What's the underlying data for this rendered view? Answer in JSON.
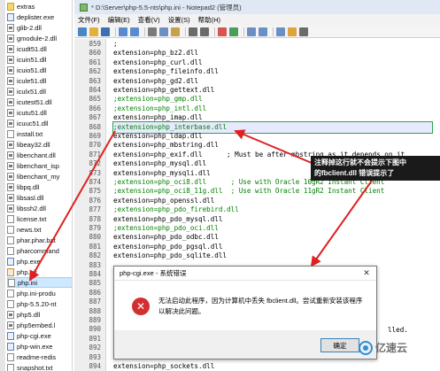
{
  "explorer": {
    "files": [
      {
        "name": "extras",
        "type": "folder"
      },
      {
        "name": "deplister.exe",
        "type": "exe"
      },
      {
        "name": "glib-2.dll",
        "type": "dll"
      },
      {
        "name": "gmodule-2.dll",
        "type": "dll"
      },
      {
        "name": "icudt51.dll",
        "type": "dll"
      },
      {
        "name": "icuin51.dll",
        "type": "dll"
      },
      {
        "name": "icuio51.dll",
        "type": "dll"
      },
      {
        "name": "icule51.dll",
        "type": "dll"
      },
      {
        "name": "iculx51.dll",
        "type": "dll"
      },
      {
        "name": "icutest51.dll",
        "type": "dll"
      },
      {
        "name": "icutu51.dll",
        "type": "dll"
      },
      {
        "name": "icuuc51.dll",
        "type": "dll"
      },
      {
        "name": "install.txt",
        "type": "txt"
      },
      {
        "name": "libeay32.dll",
        "type": "dll"
      },
      {
        "name": "libenchant.dll",
        "type": "dll"
      },
      {
        "name": "libenchant_isp",
        "type": "dll"
      },
      {
        "name": "libenchant_my",
        "type": "dll"
      },
      {
        "name": "libpq.dll",
        "type": "dll"
      },
      {
        "name": "libsasl.dll",
        "type": "dll"
      },
      {
        "name": "libssh2.dll",
        "type": "dll"
      },
      {
        "name": "license.txt",
        "type": "txt"
      },
      {
        "name": "news.txt",
        "type": "txt"
      },
      {
        "name": "phar.phar.bat",
        "type": "txt"
      },
      {
        "name": "pharcommand",
        "type": "txt"
      },
      {
        "name": "php.exe",
        "type": "exe"
      },
      {
        "name": "php.gif",
        "type": "gif"
      },
      {
        "name": "php.ini",
        "type": "ini",
        "selected": true
      },
      {
        "name": "php.ini-produ",
        "type": "ini"
      },
      {
        "name": "php-5.5.20-nt",
        "type": "txt"
      },
      {
        "name": "php5.dll",
        "type": "dll"
      },
      {
        "name": "php5embed.l",
        "type": "dll"
      },
      {
        "name": "php-cgi.exe",
        "type": "exe"
      },
      {
        "name": "php-win.exe",
        "type": "exe"
      },
      {
        "name": "readme-redis",
        "type": "txt"
      },
      {
        "name": "snapshot.txt",
        "type": "txt"
      }
    ]
  },
  "window": {
    "title": "* D:\\Server\\php-5.5-nts\\php.ini - Notepad2 (管理员)"
  },
  "menu": [
    "文件(F)",
    "编辑(E)",
    "查看(V)",
    "设置(S)",
    "帮助(H)"
  ],
  "toolbar": {
    "buttons": [
      {
        "icon": "new-file-icon",
        "color": "#4a86c5"
      },
      {
        "icon": "open-folder-icon",
        "color": "#e0b23a"
      },
      {
        "icon": "save-icon",
        "color": "#3f6fb0"
      },
      {
        "sep": true
      },
      {
        "icon": "undo-icon",
        "color": "#5a8ad0"
      },
      {
        "icon": "redo-icon",
        "color": "#5a8ad0"
      },
      {
        "sep": true
      },
      {
        "icon": "cut-icon",
        "color": "#7a7a7a"
      },
      {
        "icon": "copy-icon",
        "color": "#6a8fc0"
      },
      {
        "icon": "paste-icon",
        "color": "#c9a048"
      },
      {
        "sep": true
      },
      {
        "icon": "find-icon",
        "color": "#6b6b6b"
      },
      {
        "icon": "replace-icon",
        "color": "#6b6b6b"
      },
      {
        "sep": true
      },
      {
        "icon": "wordwrap-icon",
        "color": "#d9534f"
      },
      {
        "icon": "settings-icon",
        "color": "#4a9d5b"
      },
      {
        "sep": true
      },
      {
        "icon": "zoom-in-icon",
        "color": "#6b8fc5"
      },
      {
        "icon": "zoom-out-icon",
        "color": "#6b8fc5"
      },
      {
        "sep": true
      },
      {
        "icon": "view-icon",
        "color": "#6b8fc5"
      },
      {
        "icon": "favorites-icon",
        "color": "#e0a23a"
      },
      {
        "icon": "print-icon",
        "color": "#6b6b6b"
      }
    ]
  },
  "editor": {
    "lines": [
      {
        "no": "859",
        "text": ";",
        "style": "plain"
      },
      {
        "no": "860",
        "text": "extension=php_bz2.dll",
        "style": "plain"
      },
      {
        "no": "861",
        "text": "extension=php_curl.dll",
        "style": "plain"
      },
      {
        "no": "862",
        "text": "extension=php_fileinfo.dll",
        "style": "plain"
      },
      {
        "no": "863",
        "text": "extension=php_gd2.dll",
        "style": "plain"
      },
      {
        "no": "864",
        "text": "extension=php_gettext.dll",
        "style": "plain"
      },
      {
        "no": "865",
        "text": ";extension=php_gmp.dll",
        "style": "comment"
      },
      {
        "no": "866",
        "text": ";extension=php_intl.dll",
        "style": "comment"
      },
      {
        "no": "867",
        "text": "extension=php_imap.dll",
        "style": "plain"
      },
      {
        "no": "868",
        "text": ";extension=php_interbase.dll",
        "style": "comment-boxed"
      },
      {
        "no": "869",
        "text": "extension=php_ldap.dll",
        "style": "plain"
      },
      {
        "no": "870",
        "text": "extension=php_mbstring.dll",
        "style": "plain"
      },
      {
        "no": "871",
        "text": "extension=php_exif.dll      ; Must be after mbstring as it depends on it",
        "style": "plain"
      },
      {
        "no": "872",
        "text": "extension=php_mysql.dll",
        "style": "plain"
      },
      {
        "no": "873",
        "text": "extension=php_mysqli.dll",
        "style": "plain"
      },
      {
        "no": "874",
        "text": ";extension=php_oci8.dll      ; Use with Oracle 10gR2 Instant Client",
        "style": "comment"
      },
      {
        "no": "875",
        "text": ";extension=php_oci8_11g.dll  ; Use with Oracle 11gR2 Instant Client",
        "style": "comment"
      },
      {
        "no": "876",
        "text": "extension=php_openssl.dll",
        "style": "plain"
      },
      {
        "no": "877",
        "text": ";extension=php_pdo_firebird.dll",
        "style": "comment"
      },
      {
        "no": "878",
        "text": "extension=php_pdo_mysql.dll",
        "style": "plain"
      },
      {
        "no": "879",
        "text": ";extension=php_pdo_oci.dll",
        "style": "comment"
      },
      {
        "no": "880",
        "text": "extension=php_pdo_odbc.dll",
        "style": "plain"
      },
      {
        "no": "881",
        "text": "extension=php_pdo_pgsql.dll",
        "style": "plain"
      },
      {
        "no": "882",
        "text": "extension=php_pdo_sqlite.dll",
        "style": "plain"
      },
      {
        "no": "883",
        "text": "",
        "style": "plain"
      },
      {
        "no": "884",
        "text": "e",
        "style": "plain"
      },
      {
        "no": "885",
        "text": "e",
        "style": "plain"
      },
      {
        "no": "886",
        "text": "",
        "style": "plain"
      },
      {
        "no": "887",
        "text": "",
        "style": "plain"
      },
      {
        "no": "888",
        "text": "",
        "style": "plain"
      },
      {
        "no": "889",
        "text": "",
        "style": "plain"
      },
      {
        "no": "890",
        "text": "",
        "style": "plain"
      },
      {
        "no": "891",
        "text": "",
        "style": "plain"
      },
      {
        "no": "892",
        "text": "",
        "style": "plain"
      },
      {
        "no": "893",
        "text": "",
        "style": "plain"
      },
      {
        "no": "894",
        "text": "extension=php_sockets.dll",
        "style": "plain"
      }
    ],
    "partial_right": "lled."
  },
  "annotation": {
    "line1": "注释掉这行就不会提示下图中",
    "line2": "的fbclient.dll 错误提示了"
  },
  "dialog": {
    "title": "php-cgi.exe - 系统错误",
    "message_line1": "无法启动此程序，因为计算机中丢失 fbclient.dll。尝试重新安装该程序",
    "message_line2": "以解决此问题。",
    "ok_label": "确定",
    "close_glyph": "✕",
    "error_glyph": "✕"
  },
  "watermark": {
    "text": "亿速云"
  },
  "colors": {
    "annotation_arrow": "#e02020",
    "comment_text": "#008000"
  }
}
